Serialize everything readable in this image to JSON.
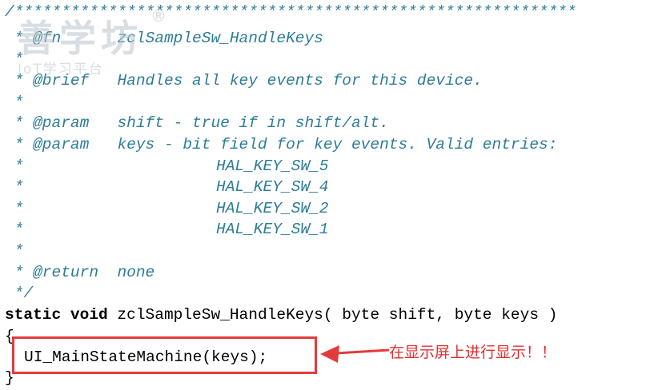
{
  "watermark": {
    "name": "善学坊",
    "subtitle": "IoT学习平台",
    "registered": "®"
  },
  "code": {
    "line_top": "/************************************************************",
    "fn_tag": " * @fn      ",
    "fn_name": "zclSampleSw_HandleKeys",
    "star1": " *",
    "brief_tag": " * @brief   ",
    "brief_text": "Handles all key events for this device.",
    "star2": " *",
    "param1_tag": " * @param   ",
    "param1_text": "shift - true if in shift/alt.",
    "param2_tag": " * @param   ",
    "param2_text": "keys - bit field for key events. Valid entries:",
    "key1_prefix": " *",
    "key1": "HAL_KEY_SW_5",
    "key2_prefix": " *",
    "key2": "HAL_KEY_SW_4",
    "key3_prefix": " *",
    "key3": "HAL_KEY_SW_2",
    "key4_prefix": " *",
    "key4": "HAL_KEY_SW_1",
    "star3": " *",
    "return_tag": " * @return  ",
    "return_text": "none",
    "comment_end": " */",
    "sig_static": "static",
    "sig_void": "void",
    "sig_rest": " zclSampleSw_HandleKeys( byte shift, byte keys )",
    "brace_open": "{",
    "body_call": "UI_MainStateMachine(keys);",
    "brace_close": "}"
  },
  "annotation": {
    "text": "在显示屏上进行显示！！",
    "color": "#e0312f"
  }
}
